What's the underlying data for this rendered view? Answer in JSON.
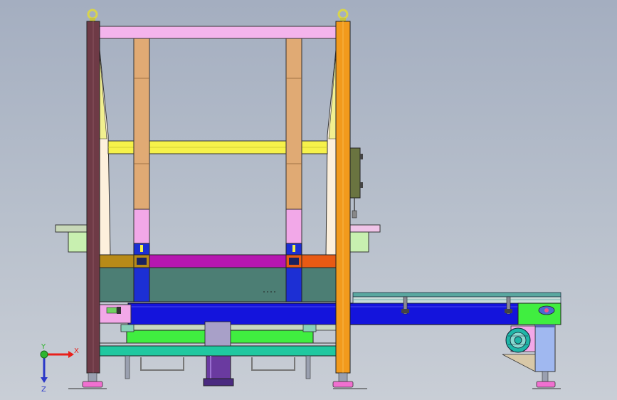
{
  "viewport": {
    "background_top": "#a4aec0",
    "background_bottom": "#c9ced6"
  },
  "triad": {
    "x_label": "X",
    "y_label": "Y",
    "z_label": "Z",
    "x_color": "#e8201b",
    "y_color": "#2fb52f",
    "z_color": "#2a37c8"
  },
  "colors": {
    "left_post": "#6e3a46",
    "right_post": "#f29a1c",
    "top_beam": "#f4b4ec",
    "inner_columns": "#e0aa74",
    "column_sleeves": "#f2a8e8",
    "cross_beam": "#f6f24a",
    "side_plates": "#fdf0dc",
    "carriage_beam_left": "#b88a18",
    "carriage_beam_mid": "#b616b0",
    "carriage_beam_right": "#e85a14",
    "dark_panel": "#4c7e74",
    "conveyor_blue": "#1414dc",
    "blue_blocks": "#1c2fd4",
    "green_frame": "#40ee40",
    "teal_frame": "#20c8a0",
    "cylinder": "#6a3aa0",
    "control_box": "#6a7440",
    "motor": "#20b6a8",
    "gearbox": "#a0b8f0",
    "roller_table": "#5aa8a0"
  }
}
